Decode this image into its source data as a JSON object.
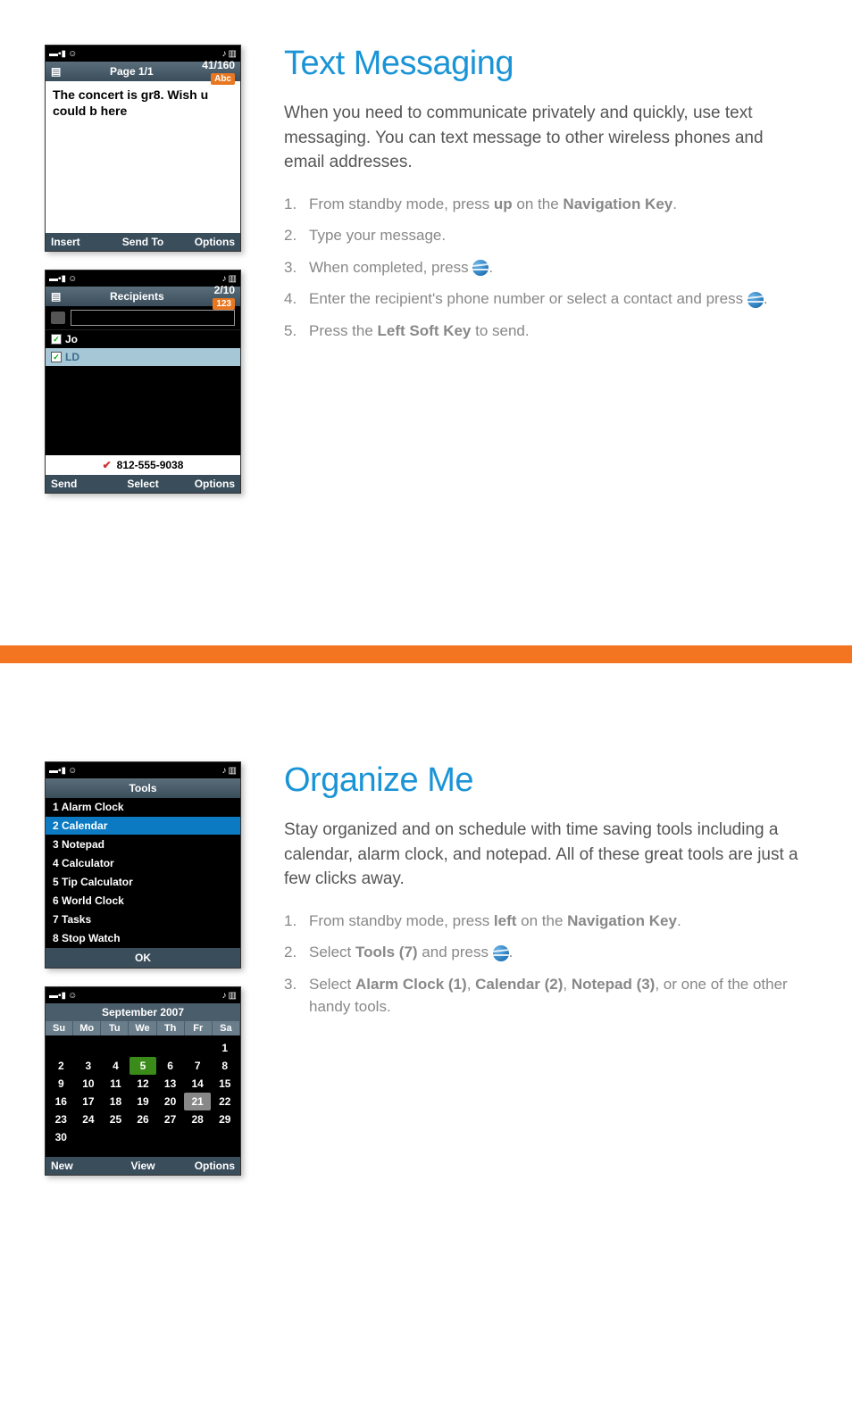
{
  "section1": {
    "heading": "Text Messaging",
    "intro": "When you need to communicate privately and quickly, use text messaging. You can text message to other wireless phones and email addresses.",
    "steps": {
      "s1_a": "From standby mode, press ",
      "s1_b": "up",
      "s1_c": " on the ",
      "s1_d": "Navigation Key",
      "s1_e": ".",
      "s2": "Type your message.",
      "s3_a": "When completed, press ",
      "s3_b": ".",
      "s4_a": "Enter the recipient's phone number or select a contact and press ",
      "s4_b": ".",
      "s5_a": "Press the ",
      "s5_b": "Left Soft Key",
      "s5_c": " to send."
    },
    "phone1": {
      "page": "Page 1/1",
      "count": "41/160",
      "mode": "Abc",
      "message": "The concert is gr8. Wish u could b here",
      "soft_left": "Insert",
      "soft_center": "Send To",
      "soft_right": "Options"
    },
    "phone2": {
      "title": "Recipients",
      "count": "2/10",
      "mode": "123",
      "recip1": "Jo",
      "recip2": "LD",
      "number": "812-555-9038",
      "soft_left": "Send",
      "soft_center": "Select",
      "soft_right": "Options"
    }
  },
  "section2": {
    "heading": "Organize Me",
    "intro": "Stay organized and on schedule with time saving tools including a calendar, alarm clock, and notepad. All of these great tools are just a few clicks away.",
    "steps": {
      "s1_a": "From standby mode, press ",
      "s1_b": "left",
      "s1_c": " on the ",
      "s1_d": "Navigation Key",
      "s1_e": ".",
      "s2_a": "Select ",
      "s2_b": "Tools (7)",
      "s2_c": " and press ",
      "s2_d": ".",
      "s3_a": "Select ",
      "s3_b": "Alarm Clock (1)",
      "s3_c": ", ",
      "s3_d": "Calendar (2)",
      "s3_e": ", ",
      "s3_f": "Notepad (3)",
      "s3_g": ", or one of the other handy tools."
    },
    "phone3": {
      "title": "Tools",
      "items": [
        "1 Alarm Clock",
        "2 Calendar",
        "3 Notepad",
        "4 Calculator",
        "5 Tip Calculator",
        "6 World Clock",
        "7 Tasks",
        "8 Stop Watch"
      ],
      "ok": "OK"
    },
    "phone4": {
      "title": "September 2007",
      "days": [
        "Su",
        "Mo",
        "Tu",
        "We",
        "Th",
        "Fr",
        "Sa"
      ],
      "weeks": [
        [
          "",
          "",
          "",
          "",
          "",
          "",
          "1"
        ],
        [
          "2",
          "3",
          "4",
          "5",
          "6",
          "7",
          "8"
        ],
        [
          "9",
          "10",
          "11",
          "12",
          "13",
          "14",
          "15"
        ],
        [
          "16",
          "17",
          "18",
          "19",
          "20",
          "21",
          "22"
        ],
        [
          "23",
          "24",
          "25",
          "26",
          "27",
          "28",
          "29"
        ],
        [
          "30",
          "",
          "",
          "",
          "",
          "",
          ""
        ]
      ],
      "soft_left": "New",
      "soft_center": "View",
      "soft_right": "Options"
    }
  }
}
